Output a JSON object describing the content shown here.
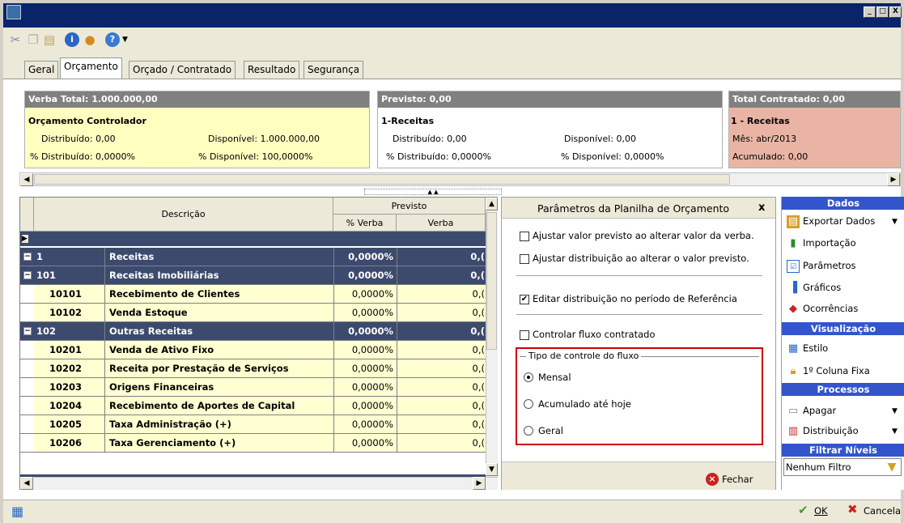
{
  "window": {
    "minimize": "_",
    "maximize": "□",
    "close": "X"
  },
  "tabs": [
    "Geral",
    "Orçamento",
    "Orçado / Contratado",
    "Resultado",
    "Segurança"
  ],
  "cards": {
    "verba": {
      "head": "Verba Total: 1.000.000,00",
      "title": "Orçamento Controlador",
      "distribuido": "Distribuído: 0,00",
      "disponivel": "Disponível: 1.000.000,00",
      "pct_distribuido": "% Distribuído: 0,0000%",
      "pct_disponivel": "% Disponível: 100,0000%",
      "color_head": "#808080",
      "color_body": "#ffffc0"
    },
    "previsto": {
      "head": "Previsto: 0,00",
      "title": "1-Receitas",
      "distribuido": "Distribuído: 0,00",
      "disponivel": "Disponível: 0,00",
      "pct_distribuido": "% Distribuído: 0,0000%",
      "pct_disponivel": "% Disponível: 0,0000%"
    },
    "contratado": {
      "head": "Total Contratado: 0,00",
      "title": "1 - Receitas",
      "mes": "Mês: abr/2013",
      "acumulado": "Acumulado: 0,00",
      "color_body": "#eab4a4"
    }
  },
  "grid": {
    "col_descricao": "Descrição",
    "col_previsto": "Previsto",
    "col_pct_verba": "% Verba",
    "col_verba": "Verba",
    "rows": [
      {
        "code": "1",
        "desc": "Receitas",
        "pct": "0,0000%",
        "verba": "0,(",
        "dark": true,
        "expander": "−"
      },
      {
        "code": "101",
        "desc": "Receitas Imobiliárias",
        "pct": "0,0000%",
        "verba": "0,(",
        "dark": true,
        "expander": "−"
      },
      {
        "code": "10101",
        "desc": "Recebimento de Clientes",
        "pct": "0,0000%",
        "verba": "0,(",
        "dark": false
      },
      {
        "code": "10102",
        "desc": "Venda Estoque",
        "pct": "0,0000%",
        "verba": "0,(",
        "dark": false
      },
      {
        "code": "102",
        "desc": "Outras Receitas",
        "pct": "0,0000%",
        "verba": "0,(",
        "dark": true,
        "expander": "−"
      },
      {
        "code": "10201",
        "desc": "Venda de Ativo Fixo",
        "pct": "0,0000%",
        "verba": "0,(",
        "dark": false
      },
      {
        "code": "10202",
        "desc": "Receita por Prestação de Serviços",
        "pct": "0,0000%",
        "verba": "0,(",
        "dark": false
      },
      {
        "code": "10203",
        "desc": "Origens Financeiras",
        "pct": "0,0000%",
        "verba": "0,(",
        "dark": false
      },
      {
        "code": "10204",
        "desc": "Recebimento de Aportes de Capital",
        "pct": "0,0000%",
        "verba": "0,(",
        "dark": false
      },
      {
        "code": "10205",
        "desc": "Taxa Administração (+)",
        "pct": "0,0000%",
        "verba": "0,(",
        "dark": false
      },
      {
        "code": "10206",
        "desc": "Taxa Gerenciamento (+)",
        "pct": "0,0000%",
        "verba": "0,(",
        "dark": false
      }
    ]
  },
  "params": {
    "title": "Parâmetros da Planilha de Orçamento",
    "close": "x",
    "opt1": "Ajustar valor previsto ao alterar valor da verba.",
    "opt2": "Ajustar distribuição ao alterar o valor previsto.",
    "opt3": "Editar distribuição no período de Referência",
    "opt4": "Controlar fluxo contratado",
    "opt1_checked": false,
    "opt2_checked": false,
    "opt3_checked": true,
    "opt4_checked": false,
    "group_title": "Tipo de controle do fluxo",
    "radio1": "Mensal",
    "radio2": "Acumulado até hoje",
    "radio3": "Geral",
    "selected": "Mensal",
    "fechar": "Fechar",
    "highlight_color": "#cc0000"
  },
  "sidebar": {
    "dados": "Dados",
    "exportar": "Exportar Dados",
    "importacao": "Importação",
    "parametros": "Parâmetros",
    "graficos": "Gráficos",
    "ocorrencias": "Ocorrências",
    "visualizacao": "Visualização",
    "estilo": "Estilo",
    "primeira_coluna": "1º Coluna Fixa",
    "processos": "Processos",
    "apagar": "Apagar",
    "distribuicao": "Distribuição",
    "filtrar": "Filtrar Níveis",
    "filtro_value": "Nenhum Filtro",
    "header_color": "#3355cc"
  },
  "footer": {
    "ok": "OK",
    "cancela": "Cancela"
  }
}
